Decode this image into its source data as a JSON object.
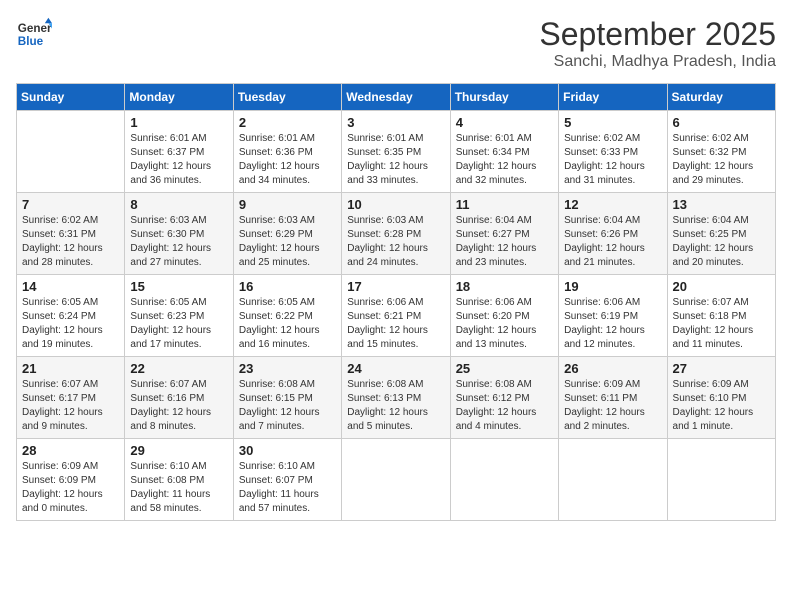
{
  "logo": {
    "line1": "General",
    "line2": "Blue"
  },
  "title": "September 2025",
  "subtitle": "Sanchi, Madhya Pradesh, India",
  "days_of_week": [
    "Sunday",
    "Monday",
    "Tuesday",
    "Wednesday",
    "Thursday",
    "Friday",
    "Saturday"
  ],
  "weeks": [
    [
      {
        "day": "",
        "detail": ""
      },
      {
        "day": "1",
        "detail": "Sunrise: 6:01 AM\nSunset: 6:37 PM\nDaylight: 12 hours\nand 36 minutes."
      },
      {
        "day": "2",
        "detail": "Sunrise: 6:01 AM\nSunset: 6:36 PM\nDaylight: 12 hours\nand 34 minutes."
      },
      {
        "day": "3",
        "detail": "Sunrise: 6:01 AM\nSunset: 6:35 PM\nDaylight: 12 hours\nand 33 minutes."
      },
      {
        "day": "4",
        "detail": "Sunrise: 6:01 AM\nSunset: 6:34 PM\nDaylight: 12 hours\nand 32 minutes."
      },
      {
        "day": "5",
        "detail": "Sunrise: 6:02 AM\nSunset: 6:33 PM\nDaylight: 12 hours\nand 31 minutes."
      },
      {
        "day": "6",
        "detail": "Sunrise: 6:02 AM\nSunset: 6:32 PM\nDaylight: 12 hours\nand 29 minutes."
      }
    ],
    [
      {
        "day": "7",
        "detail": "Sunrise: 6:02 AM\nSunset: 6:31 PM\nDaylight: 12 hours\nand 28 minutes."
      },
      {
        "day": "8",
        "detail": "Sunrise: 6:03 AM\nSunset: 6:30 PM\nDaylight: 12 hours\nand 27 minutes."
      },
      {
        "day": "9",
        "detail": "Sunrise: 6:03 AM\nSunset: 6:29 PM\nDaylight: 12 hours\nand 25 minutes."
      },
      {
        "day": "10",
        "detail": "Sunrise: 6:03 AM\nSunset: 6:28 PM\nDaylight: 12 hours\nand 24 minutes."
      },
      {
        "day": "11",
        "detail": "Sunrise: 6:04 AM\nSunset: 6:27 PM\nDaylight: 12 hours\nand 23 minutes."
      },
      {
        "day": "12",
        "detail": "Sunrise: 6:04 AM\nSunset: 6:26 PM\nDaylight: 12 hours\nand 21 minutes."
      },
      {
        "day": "13",
        "detail": "Sunrise: 6:04 AM\nSunset: 6:25 PM\nDaylight: 12 hours\nand 20 minutes."
      }
    ],
    [
      {
        "day": "14",
        "detail": "Sunrise: 6:05 AM\nSunset: 6:24 PM\nDaylight: 12 hours\nand 19 minutes."
      },
      {
        "day": "15",
        "detail": "Sunrise: 6:05 AM\nSunset: 6:23 PM\nDaylight: 12 hours\nand 17 minutes."
      },
      {
        "day": "16",
        "detail": "Sunrise: 6:05 AM\nSunset: 6:22 PM\nDaylight: 12 hours\nand 16 minutes."
      },
      {
        "day": "17",
        "detail": "Sunrise: 6:06 AM\nSunset: 6:21 PM\nDaylight: 12 hours\nand 15 minutes."
      },
      {
        "day": "18",
        "detail": "Sunrise: 6:06 AM\nSunset: 6:20 PM\nDaylight: 12 hours\nand 13 minutes."
      },
      {
        "day": "19",
        "detail": "Sunrise: 6:06 AM\nSunset: 6:19 PM\nDaylight: 12 hours\nand 12 minutes."
      },
      {
        "day": "20",
        "detail": "Sunrise: 6:07 AM\nSunset: 6:18 PM\nDaylight: 12 hours\nand 11 minutes."
      }
    ],
    [
      {
        "day": "21",
        "detail": "Sunrise: 6:07 AM\nSunset: 6:17 PM\nDaylight: 12 hours\nand 9 minutes."
      },
      {
        "day": "22",
        "detail": "Sunrise: 6:07 AM\nSunset: 6:16 PM\nDaylight: 12 hours\nand 8 minutes."
      },
      {
        "day": "23",
        "detail": "Sunrise: 6:08 AM\nSunset: 6:15 PM\nDaylight: 12 hours\nand 7 minutes."
      },
      {
        "day": "24",
        "detail": "Sunrise: 6:08 AM\nSunset: 6:13 PM\nDaylight: 12 hours\nand 5 minutes."
      },
      {
        "day": "25",
        "detail": "Sunrise: 6:08 AM\nSunset: 6:12 PM\nDaylight: 12 hours\nand 4 minutes."
      },
      {
        "day": "26",
        "detail": "Sunrise: 6:09 AM\nSunset: 6:11 PM\nDaylight: 12 hours\nand 2 minutes."
      },
      {
        "day": "27",
        "detail": "Sunrise: 6:09 AM\nSunset: 6:10 PM\nDaylight: 12 hours\nand 1 minute."
      }
    ],
    [
      {
        "day": "28",
        "detail": "Sunrise: 6:09 AM\nSunset: 6:09 PM\nDaylight: 12 hours\nand 0 minutes."
      },
      {
        "day": "29",
        "detail": "Sunrise: 6:10 AM\nSunset: 6:08 PM\nDaylight: 11 hours\nand 58 minutes."
      },
      {
        "day": "30",
        "detail": "Sunrise: 6:10 AM\nSunset: 6:07 PM\nDaylight: 11 hours\nand 57 minutes."
      },
      {
        "day": "",
        "detail": ""
      },
      {
        "day": "",
        "detail": ""
      },
      {
        "day": "",
        "detail": ""
      },
      {
        "day": "",
        "detail": ""
      }
    ]
  ]
}
